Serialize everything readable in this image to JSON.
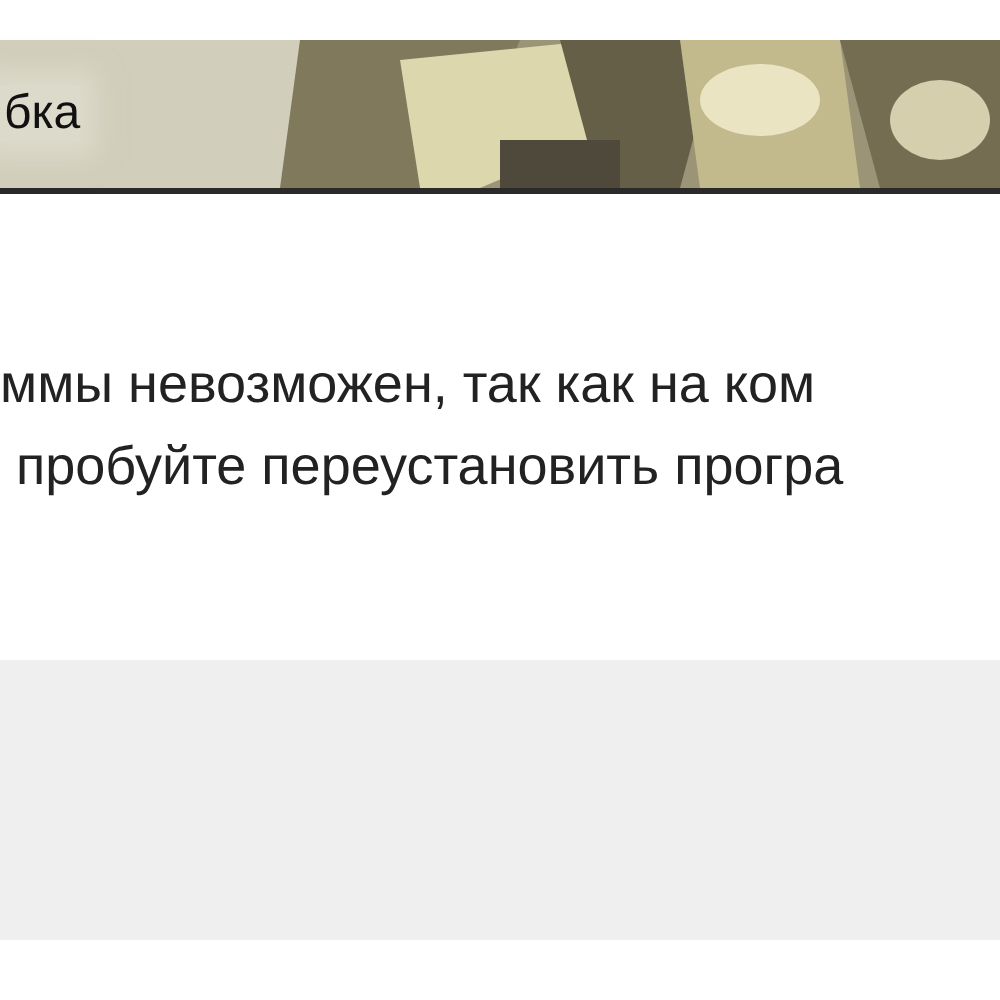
{
  "window": {
    "title": "бка"
  },
  "message": {
    "lines": [
      "ммы невозможен, так как на ком",
      "пробуйте переустановить програ"
    ]
  }
}
